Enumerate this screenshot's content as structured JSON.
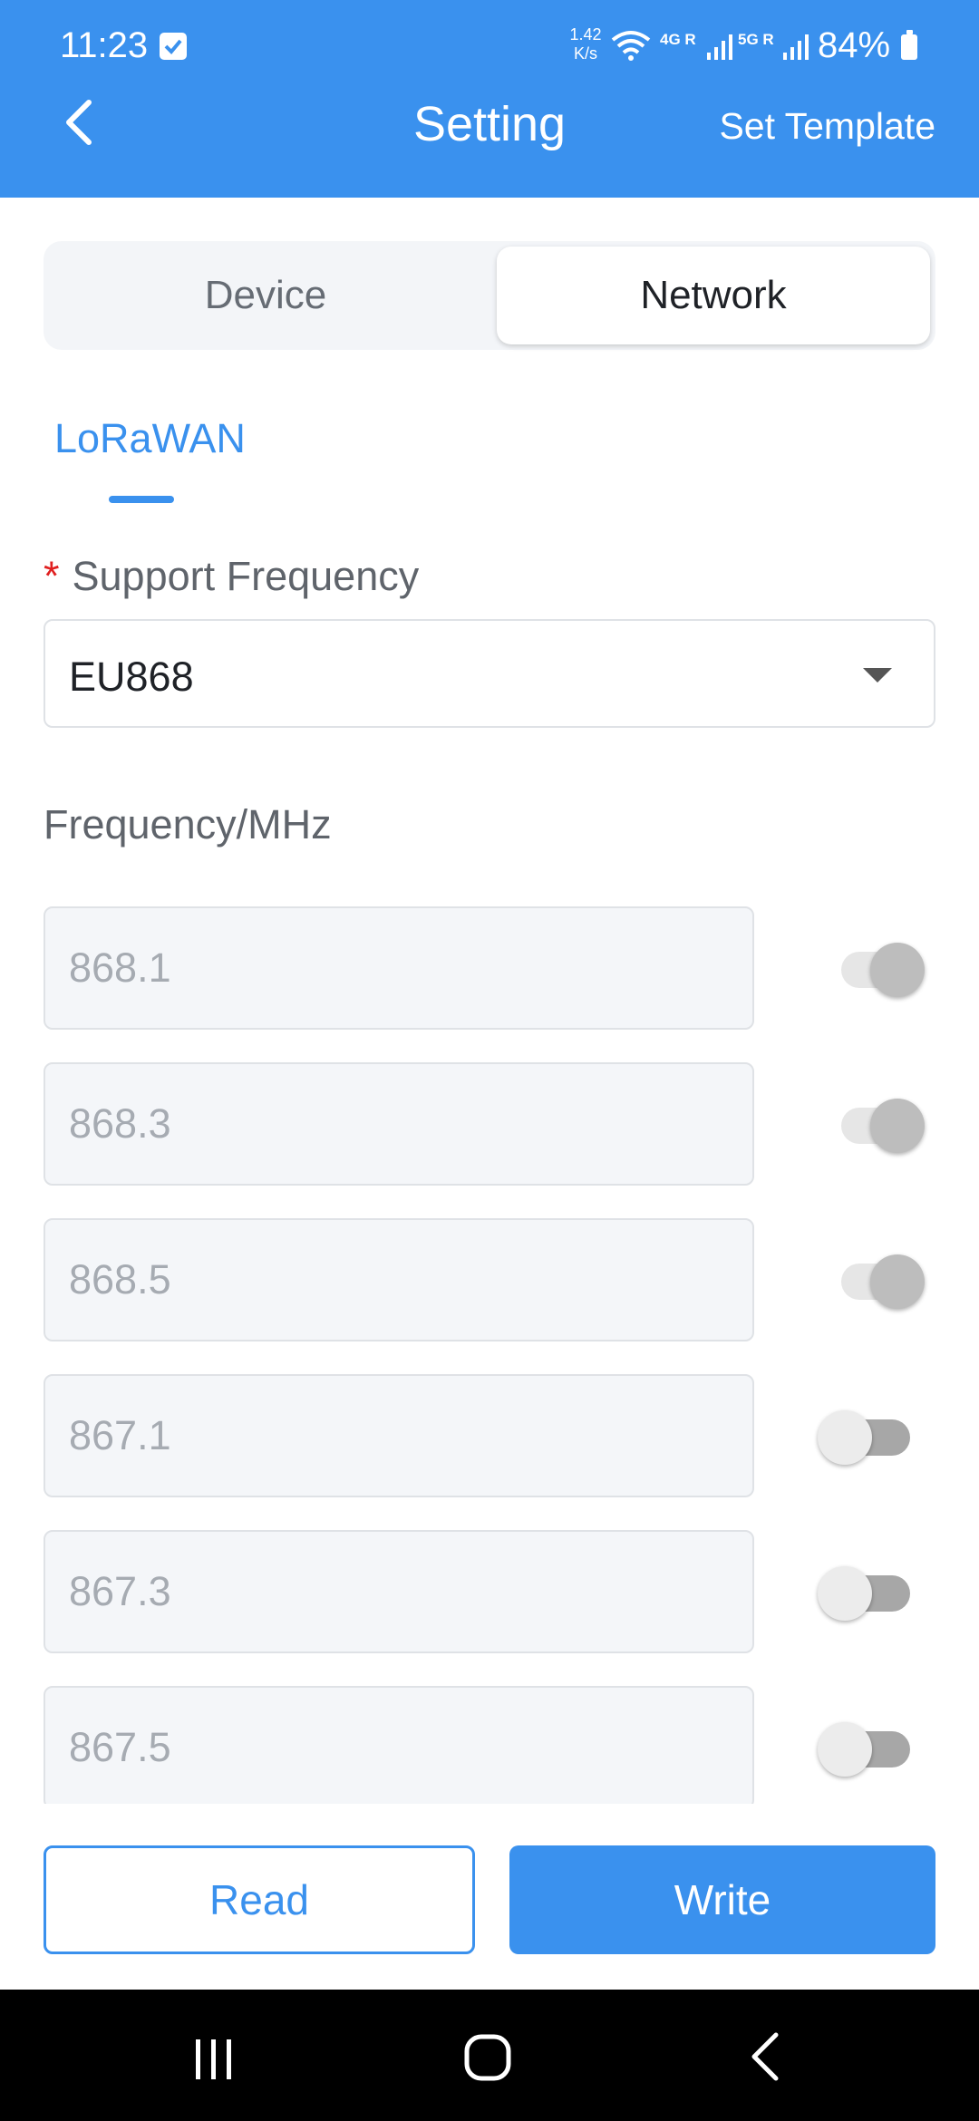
{
  "status_bar": {
    "time": "11:23",
    "speed_value": "1.42",
    "speed_unit": "K/s",
    "net_4g": "4G R",
    "net_5g": "5G R",
    "battery": "84%"
  },
  "header": {
    "title": "Setting",
    "action": "Set Template"
  },
  "tabs": [
    {
      "label": "Device",
      "active": false
    },
    {
      "label": "Network",
      "active": true
    }
  ],
  "sub_tab": {
    "label": "LoRaWAN"
  },
  "support_frequency": {
    "required_mark": "*",
    "label": "Support Frequency",
    "value": "EU868"
  },
  "frequency_section": {
    "label": "Frequency/MHz",
    "channels": [
      {
        "value": "868.1",
        "enabled": true
      },
      {
        "value": "868.3",
        "enabled": true
      },
      {
        "value": "868.5",
        "enabled": true
      },
      {
        "value": "867.1",
        "enabled": false
      },
      {
        "value": "867.3",
        "enabled": false
      },
      {
        "value": "867.5",
        "enabled": false
      }
    ]
  },
  "actions": {
    "read_label": "Read",
    "write_label": "Write"
  },
  "colors": {
    "primary": "#3a91ee",
    "required": "#e02020"
  }
}
